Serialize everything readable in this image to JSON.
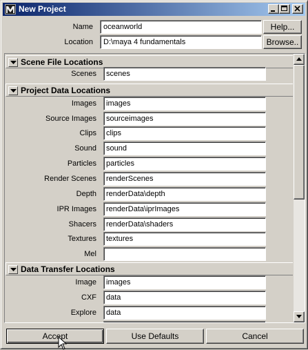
{
  "window": {
    "title": "New Project",
    "icon": "maya-logo-icon"
  },
  "header": {
    "name_label": "Name",
    "name_value": "oceanworld",
    "location_label": "Location",
    "location_value": "D:\\maya 4 fundamentals",
    "help_button": "Help...",
    "browse_button": "Browse.."
  },
  "sections": {
    "scene_files": {
      "title": "Scene File Locations",
      "rows": [
        {
          "label": "Scenes",
          "value": "scenes"
        }
      ]
    },
    "project_data": {
      "title": "Project Data Locations",
      "rows": [
        {
          "label": "Images",
          "value": "images"
        },
        {
          "label": "Source Images",
          "value": "sourceimages"
        },
        {
          "label": "Clips",
          "value": "clips"
        },
        {
          "label": "Sound",
          "value": "sound"
        },
        {
          "label": "Particles",
          "value": "particles"
        },
        {
          "label": "Render Scenes",
          "value": "renderScenes"
        },
        {
          "label": "Depth",
          "value": "renderData\\depth"
        },
        {
          "label": "IPR Images",
          "value": "renderData\\iprImages"
        },
        {
          "label": "Shacers",
          "value": "renderData\\shaders"
        },
        {
          "label": "Textures",
          "value": "textures"
        },
        {
          "label": "Mel",
          "value": ""
        }
      ]
    },
    "data_transfer": {
      "title": "Data Transfer Locations",
      "rows": [
        {
          "label": "Image",
          "value": "images"
        },
        {
          "label": "CXF",
          "value": "data"
        },
        {
          "label": "Explore",
          "value": "data"
        }
      ]
    }
  },
  "footer": {
    "accept": "Accept",
    "use_defaults": "Use Defaults",
    "cancel": "Cancel"
  },
  "colors": {
    "titlebar_start": "#0a246a",
    "titlebar_end": "#a6caf0",
    "face": "#d4d0c8"
  }
}
